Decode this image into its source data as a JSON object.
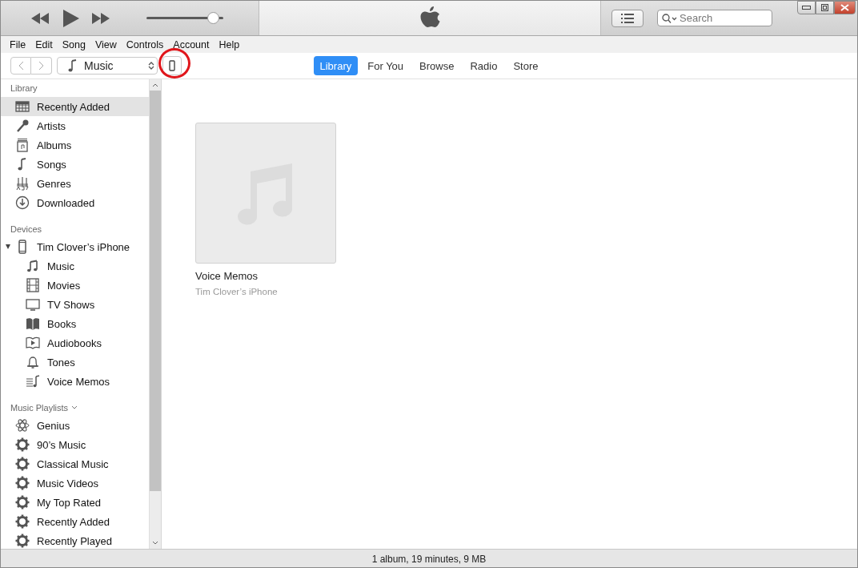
{
  "player": {
    "volume": {
      "level": 0.94
    }
  },
  "search": {
    "placeholder": "Search"
  },
  "menu": [
    "File",
    "Edit",
    "Song",
    "View",
    "Controls",
    "Account",
    "Help"
  ],
  "media_picker": {
    "value": "Music"
  },
  "tabs": [
    {
      "label": "Library",
      "selected": true
    },
    {
      "label": "For You",
      "selected": false
    },
    {
      "label": "Browse",
      "selected": false
    },
    {
      "label": "Radio",
      "selected": false
    },
    {
      "label": "Store",
      "selected": false
    }
  ],
  "sidebar": {
    "library": {
      "title": "Library",
      "items": [
        {
          "label": "Recently Added",
          "kind": "recent",
          "selected": true
        },
        {
          "label": "Artists",
          "kind": "artists",
          "selected": false
        },
        {
          "label": "Albums",
          "kind": "albums",
          "selected": false
        },
        {
          "label": "Songs",
          "kind": "songs",
          "selected": false
        },
        {
          "label": "Genres",
          "kind": "genres",
          "selected": false
        },
        {
          "label": "Downloaded",
          "kind": "downloaded",
          "selected": false
        }
      ]
    },
    "devices": {
      "title": "Devices",
      "items": [
        {
          "label": "Tim Clover’s iPhone",
          "kind": "phone",
          "selected": false,
          "expanded": true,
          "children": [
            {
              "label": "Music",
              "kind": "music",
              "selected": false
            },
            {
              "label": "Movies",
              "kind": "movies",
              "selected": false
            },
            {
              "label": "TV Shows",
              "kind": "tv",
              "selected": false
            },
            {
              "label": "Books",
              "kind": "books",
              "selected": false
            },
            {
              "label": "Audiobooks",
              "kind": "audiobooks",
              "selected": false
            },
            {
              "label": "Tones",
              "kind": "tones",
              "selected": false
            },
            {
              "label": "Voice Memos",
              "kind": "memos",
              "selected": false
            }
          ]
        }
      ]
    },
    "playlists": {
      "title": "Music Playlists",
      "items": [
        {
          "label": "Genius",
          "kind": "genius",
          "selected": false
        },
        {
          "label": "90’s Music",
          "kind": "smart",
          "selected": false
        },
        {
          "label": "Classical Music",
          "kind": "smart",
          "selected": false
        },
        {
          "label": "Music Videos",
          "kind": "smart",
          "selected": false
        },
        {
          "label": "My Top Rated",
          "kind": "smart",
          "selected": false
        },
        {
          "label": "Recently Added",
          "kind": "smart",
          "selected": false
        },
        {
          "label": "Recently Played",
          "kind": "smart",
          "selected": false
        }
      ]
    }
  },
  "albums": [
    {
      "title": "Voice Memos",
      "subtitle": "Tim Clover’s iPhone"
    }
  ],
  "status_bar": "1 album, 19 minutes, 9 MB"
}
